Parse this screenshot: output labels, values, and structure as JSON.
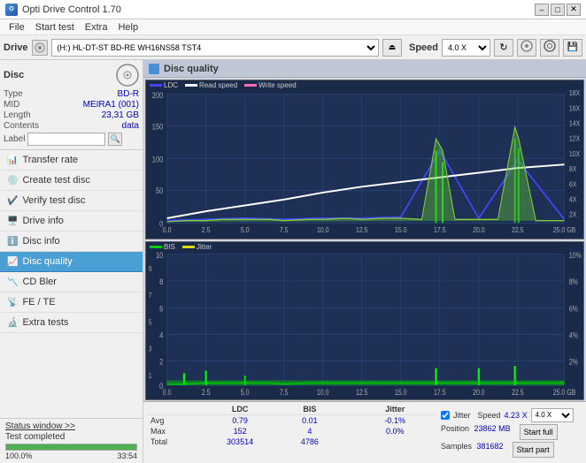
{
  "titleBar": {
    "title": "Opti Drive Control 1.70",
    "minBtn": "–",
    "maxBtn": "□",
    "closeBtn": "✕"
  },
  "menuBar": {
    "items": [
      "File",
      "Start test",
      "Extra",
      "Help"
    ]
  },
  "drive": {
    "label": "Drive",
    "driveValue": "(H:)  HL-DT-ST BD-RE  WH16NS58 TST4",
    "speedLabel": "Speed",
    "speedValue": "4.0 X"
  },
  "disc": {
    "title": "Disc",
    "typeLabel": "Type",
    "typeValue": "BD-R",
    "midLabel": "MID",
    "midValue": "MEIRA1 (001)",
    "lengthLabel": "Length",
    "lengthValue": "23,31 GB",
    "contentsLabel": "Contents",
    "contentsValue": "data",
    "labelLabel": "Label"
  },
  "navItems": [
    {
      "id": "transfer-rate",
      "label": "Transfer rate",
      "active": false
    },
    {
      "id": "create-test-disc",
      "label": "Create test disc",
      "active": false
    },
    {
      "id": "verify-test-disc",
      "label": "Verify test disc",
      "active": false
    },
    {
      "id": "drive-info",
      "label": "Drive info",
      "active": false
    },
    {
      "id": "disc-info",
      "label": "Disc info",
      "active": false
    },
    {
      "id": "disc-quality",
      "label": "Disc quality",
      "active": true
    },
    {
      "id": "cd-bler",
      "label": "CD Bler",
      "active": false
    },
    {
      "id": "fe-te",
      "label": "FE / TE",
      "active": false
    },
    {
      "id": "extra-tests",
      "label": "Extra tests",
      "active": false
    }
  ],
  "statusWindow": {
    "btnLabel": "Status window >>",
    "statusText": "Test completed",
    "progress": 100,
    "progressLabel": "100.0%",
    "timeLabel": "33:54"
  },
  "panel": {
    "title": "Disc quality"
  },
  "chart1": {
    "title": "LDC",
    "legend": [
      {
        "label": "LDC",
        "color": "#0000ff"
      },
      {
        "label": "Read speed",
        "color": "#ffffff"
      },
      {
        "label": "Write speed",
        "color": "#ff69b4"
      }
    ],
    "yAxisLeft": [
      "200",
      "150",
      "100",
      "50",
      "0"
    ],
    "yAxisRight": [
      "18X",
      "16X",
      "14X",
      "12X",
      "10X",
      "8X",
      "6X",
      "4X",
      "2X"
    ],
    "xAxis": [
      "0.0",
      "2.5",
      "5.0",
      "7.5",
      "10.0",
      "12.5",
      "15.0",
      "17.5",
      "20.0",
      "22.5",
      "25.0 GB"
    ]
  },
  "chart2": {
    "title": "BIS",
    "legend": [
      {
        "label": "BIS",
        "color": "#00ff00"
      },
      {
        "label": "Jitter",
        "color": "#ffff00"
      }
    ],
    "yAxisLeft": [
      "10",
      "9",
      "8",
      "7",
      "6",
      "5",
      "4",
      "3",
      "2",
      "1"
    ],
    "yAxisRight": [
      "10%",
      "8%",
      "6%",
      "4%",
      "2%"
    ],
    "xAxis": [
      "0.0",
      "2.5",
      "5.0",
      "7.5",
      "10.0",
      "12.5",
      "15.0",
      "17.5",
      "20.0",
      "22.5",
      "25.0 GB"
    ]
  },
  "stats": {
    "columns": [
      "",
      "LDC",
      "BIS",
      "",
      "Jitter",
      "Speed"
    ],
    "rows": [
      {
        "label": "Avg",
        "ldc": "0.79",
        "bis": "0.01",
        "jitter": "-0.1%",
        "speed": ""
      },
      {
        "label": "Max",
        "ldc": "152",
        "bis": "4",
        "jitter": "0.0%",
        "speed": ""
      },
      {
        "label": "Total",
        "ldc": "303514",
        "bis": "4786",
        "jitter": "",
        "speed": ""
      }
    ],
    "jitterChecked": true,
    "speedValue": "4.23 X",
    "speedDropdown": "4.0 X",
    "positionLabel": "Position",
    "positionValue": "23862 MB",
    "samplesLabel": "Samples",
    "samplesValue": "381682",
    "startFullBtn": "Start full",
    "startPartBtn": "Start part"
  }
}
